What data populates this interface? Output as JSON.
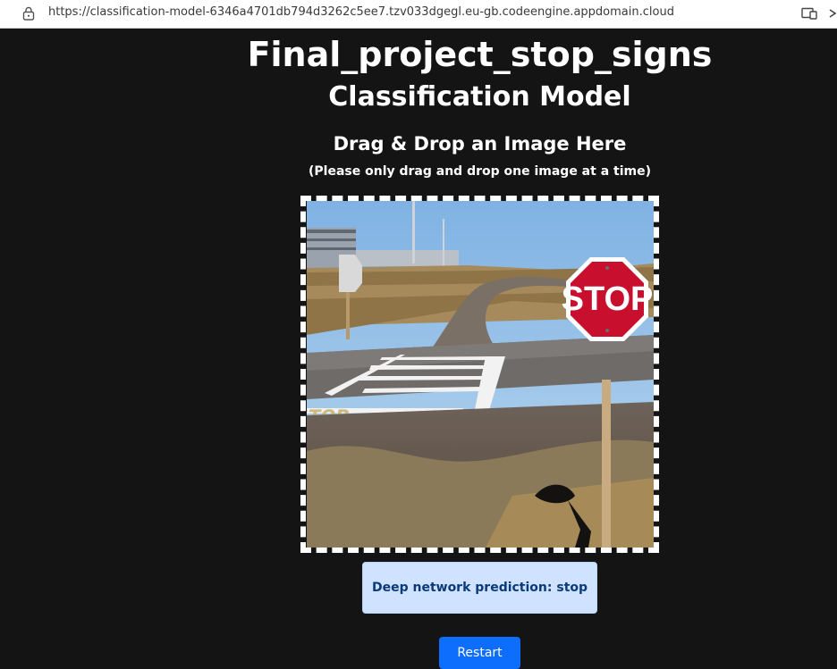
{
  "browser": {
    "url": "https://classification-model-6346a4701db794d3262c5ee7.tzv033dgegl.eu-gb.codeengine.appdomain.cloud",
    "icons": [
      "lock-icon",
      "reader-mode-icon",
      "chevron-icon"
    ]
  },
  "page": {
    "title": "Final_project_stop_signs",
    "subtitle": "Classification Model",
    "dropzone": {
      "heading": "Drag & Drop an Image Here",
      "note": "(Please only drag and drop one image at a time)",
      "image_sign_text": "STOP",
      "image_road_text": "STOP"
    },
    "prediction": {
      "label": "Deep network prediction: stop"
    },
    "restart_button": {
      "label": "Restart"
    }
  },
  "colors": {
    "background": "#141414",
    "prediction_bg": "#cfe2ff",
    "prediction_text": "#0a3a7a",
    "button": "#0d6efd",
    "stop_sign": "#c8102e"
  }
}
